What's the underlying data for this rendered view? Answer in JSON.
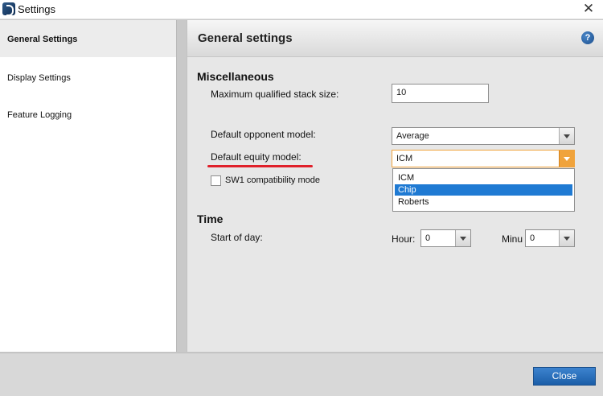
{
  "window": {
    "title": "Settings",
    "close_glyph": "✕"
  },
  "sidebar": {
    "items": [
      {
        "label": "General Settings",
        "active": true
      },
      {
        "label": "Display Settings",
        "active": false
      },
      {
        "label": "Feature Logging",
        "active": false
      }
    ]
  },
  "panel": {
    "title": "General settings",
    "help_glyph": "?",
    "misc": {
      "heading": "Miscellaneous",
      "max_stack_label": "Maximum qualified stack size:",
      "max_stack_value": "10",
      "opponent_label": "Default opponent model:",
      "opponent_value": "Average",
      "equity_label": "Default equity model:",
      "equity_value": "ICM",
      "equity_options": [
        "ICM",
        "Chip",
        "Roberts"
      ],
      "equity_highlighted": "Chip",
      "sw1_label": "SW1 compatibility mode",
      "sw1_checked": false
    },
    "time": {
      "heading": "Time",
      "start_label": "Start of day:",
      "hour_label": "Hour:",
      "hour_value": "0",
      "minute_label": "Minu",
      "minute_value": "0"
    }
  },
  "footer": {
    "close_label": "Close"
  },
  "colors": {
    "accent": "#1f7ad3",
    "focus": "#f0a33c",
    "annotation": "#e0202a"
  },
  "icons": {
    "app": "app-logo-icon",
    "help": "help-icon",
    "close": "close-icon",
    "dropdown": "chevron-down-icon"
  }
}
